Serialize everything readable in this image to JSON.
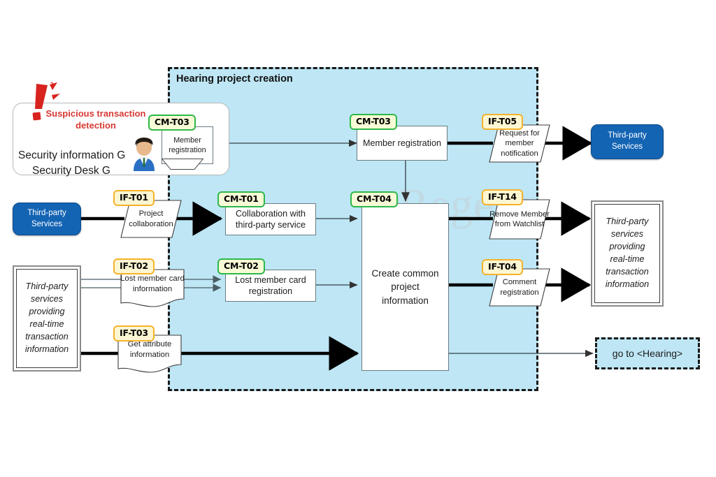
{
  "diagram": {
    "title": "Hearing project creation",
    "watermark": "Regent"
  },
  "actor_group": {
    "alert_text": "Suspicious transaction detection",
    "label_line1": "Security information G",
    "label_line2": "Security Desk G",
    "alert_icon": "exclamation-alert-icon",
    "person_icon": "business-person-icon"
  },
  "badges": {
    "cm_t03_left": "CM-T03",
    "cm_t03_center": "CM-T03",
    "cm_t01": "CM-T01",
    "cm_t02": "CM-T02",
    "cm_t04": "CM-T04",
    "if_t01": "IF-T01",
    "if_t02": "IF-T02",
    "if_t03": "IF-T03",
    "if_t04": "IF-T04",
    "if_t05": "IF-T05",
    "if_t14": "IF-T14"
  },
  "tasks": {
    "member_registration_left": "Member registration",
    "member_registration_center": "Member registration",
    "collaboration_third_party": "Collaboration with third-party service",
    "lost_member_card_registration": "Lost member card registration",
    "create_common_project_information": "Create common project information"
  },
  "interfaces": {
    "project_collaboration": "Project collaboration",
    "lost_member_card_information": "Lost member card information",
    "get_attribute_information": "Get attribute information",
    "request_for_member_notification": "Request for member notification",
    "remove_member_from_watchlist": "Remove Member from Watchlist",
    "comment_registration": "Comment registration"
  },
  "external": {
    "third_party_services_top": "Third-party Services",
    "third_party_services_left": "Third-party Services",
    "realtime_store_left": "Third-party services providing real-time transaction information",
    "realtime_store_right": "Third-party services providing real-time transaction information"
  },
  "goto": {
    "label": "go to <Hearing>"
  },
  "colors": {
    "phase_fill": "#bee6f5",
    "phase_border": "#1a1a1a",
    "badge_green": "#2eb84a",
    "badge_amber": "#f5b32b",
    "external_blue": "#1464b4",
    "alert_red": "#d63a34",
    "watermark": "#c3d8e2"
  }
}
